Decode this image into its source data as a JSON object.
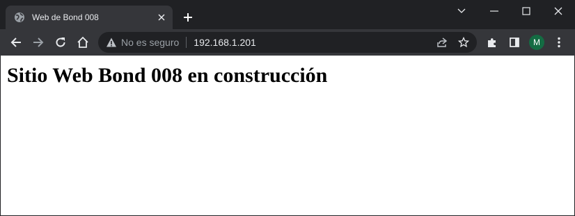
{
  "browser": {
    "tab": {
      "title": "Web de Bond 008",
      "icon": "globe-icon"
    },
    "omnibox": {
      "security_label": "No es seguro",
      "url": "192.168.1.201"
    },
    "profile_initial": "M",
    "colors": {
      "frame": "#202124",
      "toolbar": "#35363a",
      "avatar": "#146c43"
    }
  },
  "page": {
    "heading": "Sitio Web Bond 008 en construcción"
  }
}
